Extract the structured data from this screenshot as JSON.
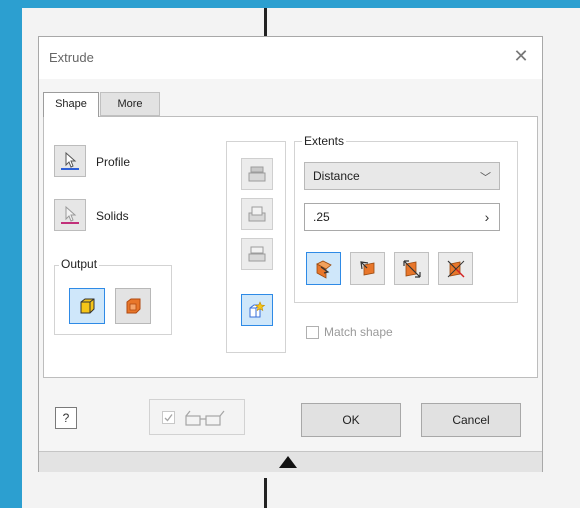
{
  "dialog": {
    "title": "Extrude"
  },
  "tabs": [
    {
      "label": "Shape"
    },
    {
      "label": "More"
    }
  ],
  "shape": {
    "profile_label": "Profile",
    "solids_label": "Solids",
    "output_label": "Output",
    "extents_label": "Extents",
    "extent_type": "Distance",
    "distance_value": ".25",
    "match_shape_label": "Match shape",
    "match_shape_checked": false
  },
  "footer": {
    "ok_label": "OK",
    "cancel_label": "Cancel",
    "help_label": "?"
  },
  "colors": {
    "accent": "#2e8ae6",
    "orange": "#e8762a",
    "yellow": "#f5c518",
    "background": "#2c9fd0"
  }
}
